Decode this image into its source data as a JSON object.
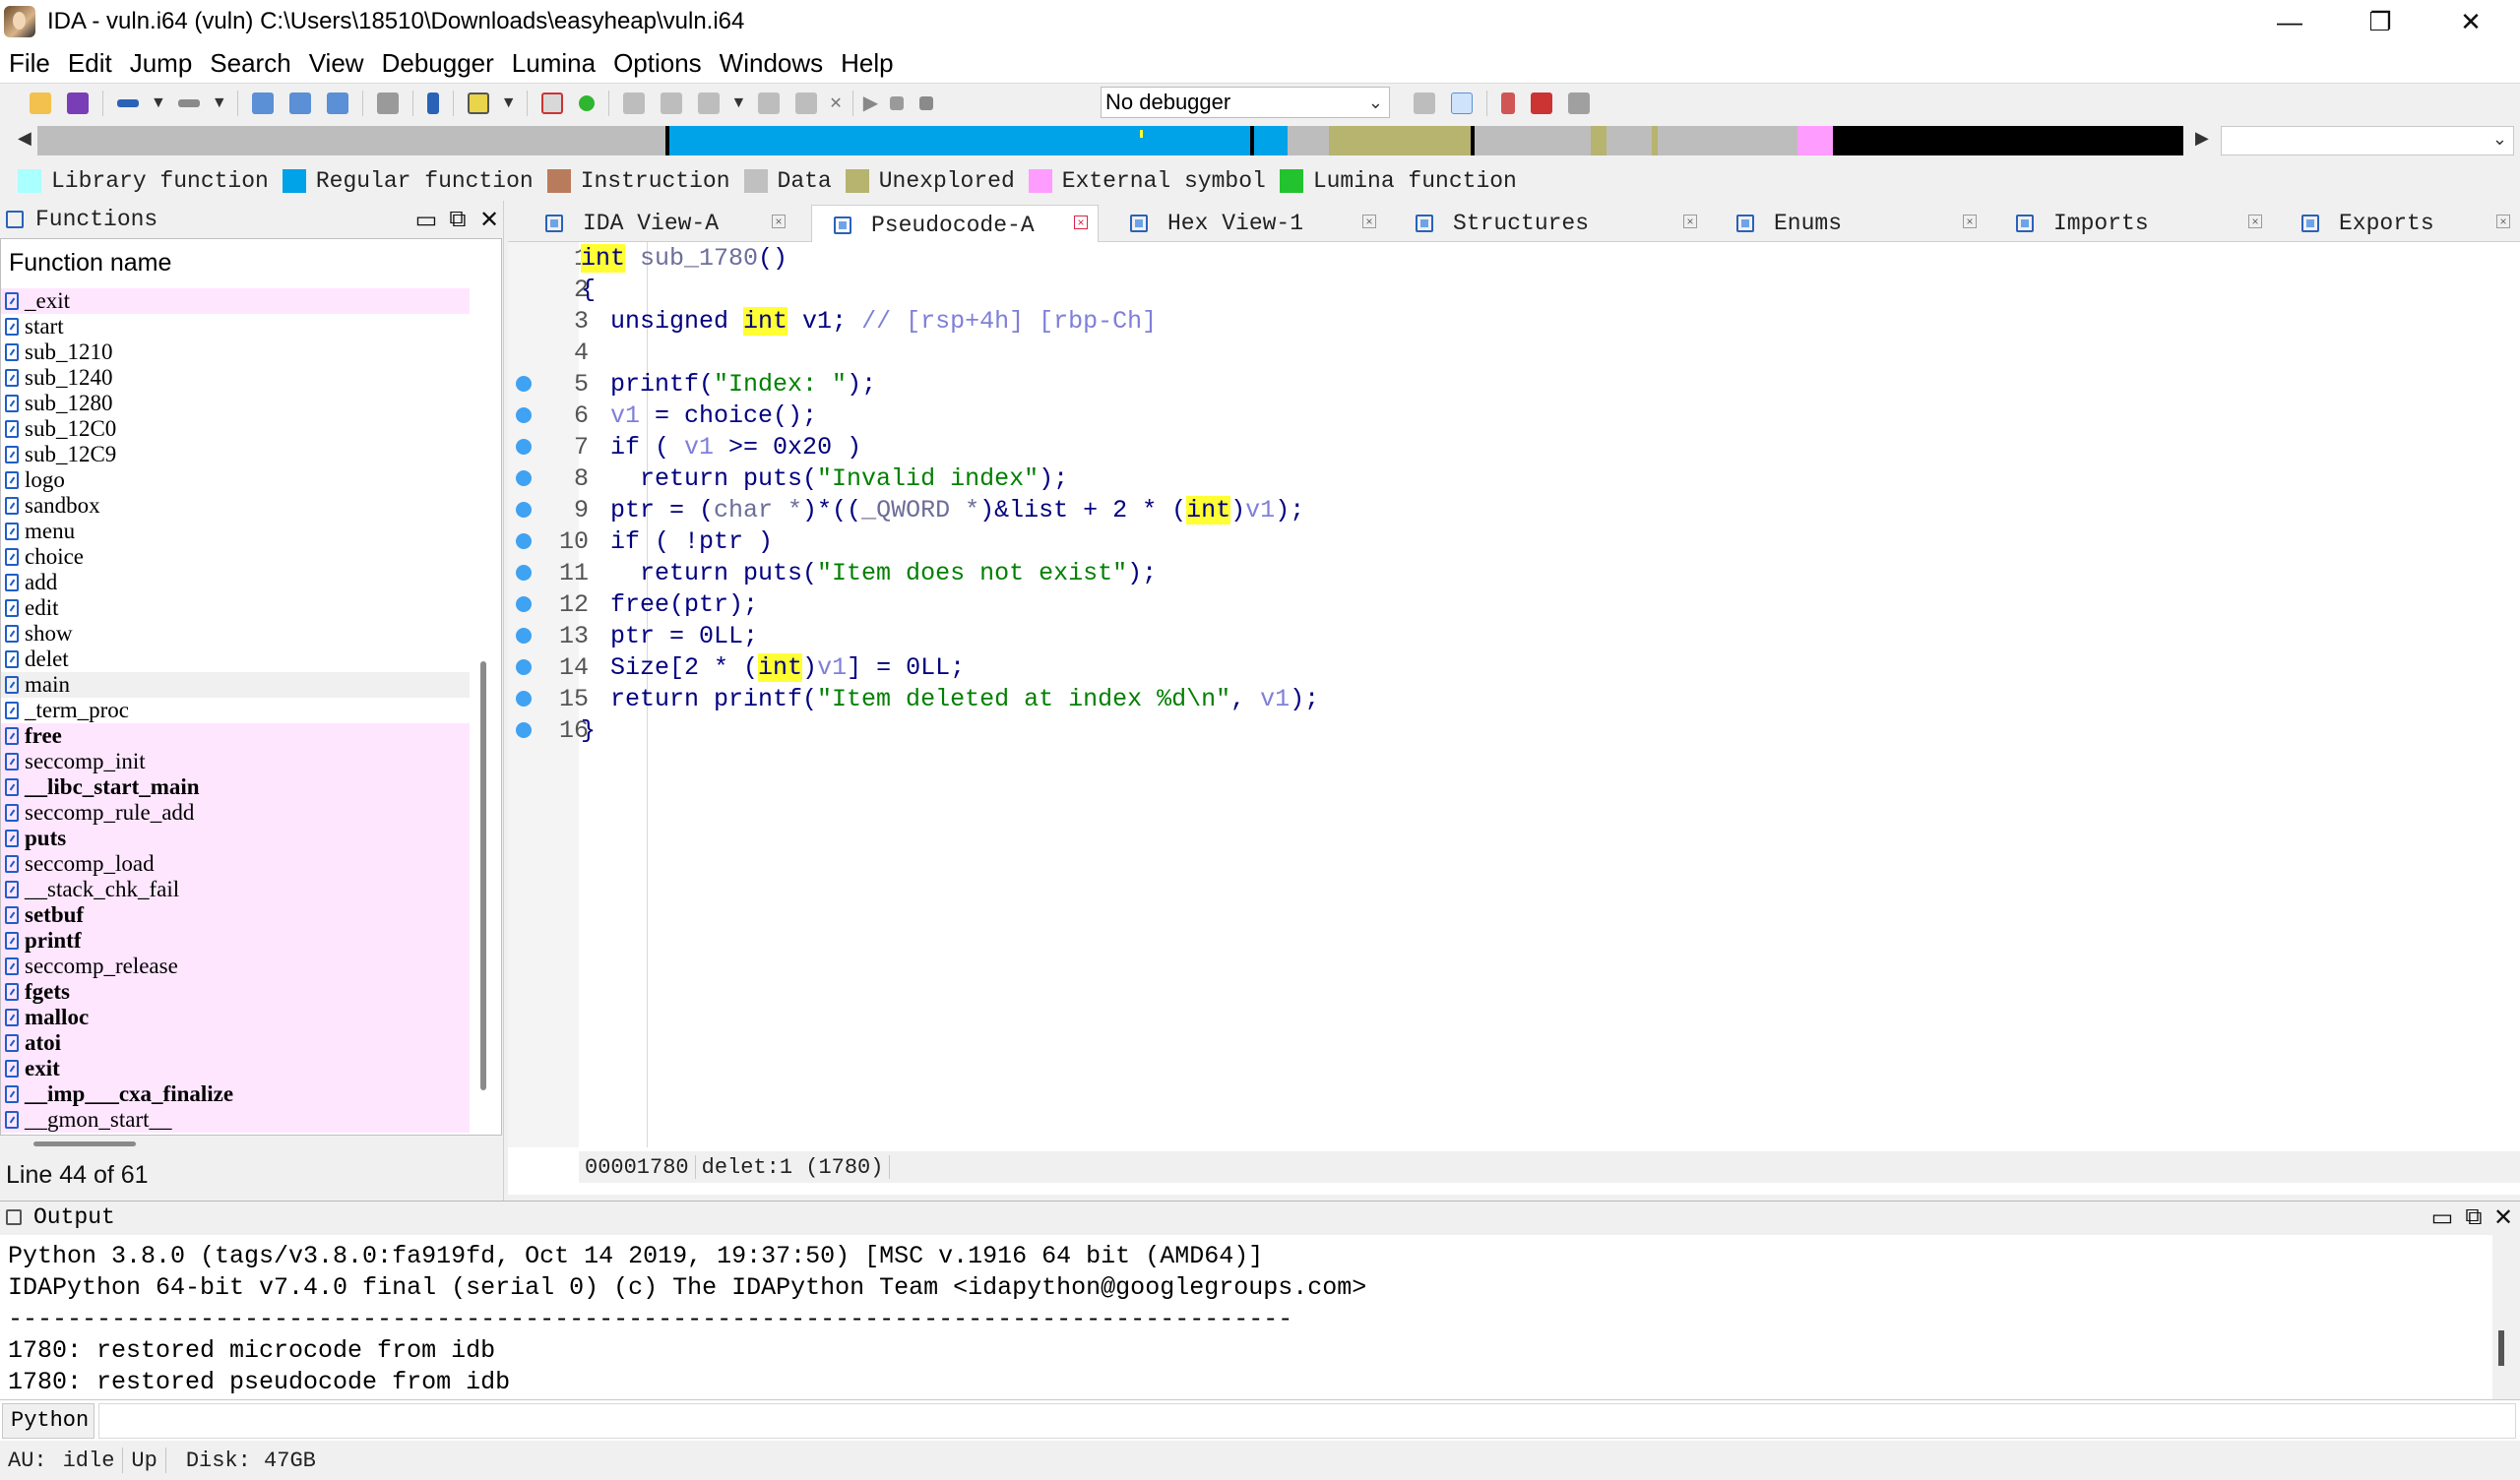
{
  "window": {
    "title": "IDA - vuln.i64 (vuln) C:\\Users\\18510\\Downloads\\easyheap\\vuln.i64",
    "minimize": "—",
    "maximize": "❐",
    "close": "✕"
  },
  "menu": [
    "File",
    "Edit",
    "Jump",
    "Search",
    "View",
    "Debugger",
    "Lumina",
    "Options",
    "Windows",
    "Help"
  ],
  "toolbar": {
    "debugger_select": "No debugger"
  },
  "legend": [
    {
      "label": "Library function",
      "color": "#aaffff"
    },
    {
      "label": "Regular function",
      "color": "#00a2e8"
    },
    {
      "label": "Instruction",
      "color": "#b87c5c"
    },
    {
      "label": "Data",
      "color": "#c0c0c0"
    },
    {
      "label": "Unexplored",
      "color": "#b6b46e"
    },
    {
      "label": "External symbol",
      "color": "#ff9cff"
    },
    {
      "label": "Lumina function",
      "color": "#22c32e"
    }
  ],
  "functions_panel": {
    "title": "Functions",
    "column_header": "Function name",
    "items": [
      {
        "name": "_exit",
        "type": "ext",
        "bold": false
      },
      {
        "name": "start",
        "type": "reg",
        "bold": false
      },
      {
        "name": "sub_1210",
        "type": "reg",
        "bold": false
      },
      {
        "name": "sub_1240",
        "type": "reg",
        "bold": false
      },
      {
        "name": "sub_1280",
        "type": "reg",
        "bold": false
      },
      {
        "name": "sub_12C0",
        "type": "reg",
        "bold": false
      },
      {
        "name": "sub_12C9",
        "type": "reg",
        "bold": false
      },
      {
        "name": "logo",
        "type": "reg",
        "bold": false
      },
      {
        "name": "sandbox",
        "type": "reg",
        "bold": false
      },
      {
        "name": "menu",
        "type": "reg",
        "bold": false
      },
      {
        "name": "choice",
        "type": "reg",
        "bold": false
      },
      {
        "name": "add",
        "type": "reg",
        "bold": false
      },
      {
        "name": "edit",
        "type": "reg",
        "bold": false
      },
      {
        "name": "show",
        "type": "reg",
        "bold": false
      },
      {
        "name": "delet",
        "type": "reg",
        "bold": false
      },
      {
        "name": "main",
        "type": "sel",
        "bold": false
      },
      {
        "name": "_term_proc",
        "type": "reg",
        "bold": false
      },
      {
        "name": "free",
        "type": "ext",
        "bold": true
      },
      {
        "name": "seccomp_init",
        "type": "ext",
        "bold": false
      },
      {
        "name": "__libc_start_main",
        "type": "ext",
        "bold": true
      },
      {
        "name": "seccomp_rule_add",
        "type": "ext",
        "bold": false
      },
      {
        "name": "puts",
        "type": "ext",
        "bold": true
      },
      {
        "name": "seccomp_load",
        "type": "ext",
        "bold": false
      },
      {
        "name": "__stack_chk_fail",
        "type": "ext",
        "bold": false
      },
      {
        "name": "setbuf",
        "type": "ext",
        "bold": true
      },
      {
        "name": "printf",
        "type": "ext",
        "bold": true
      },
      {
        "name": "seccomp_release",
        "type": "ext",
        "bold": false
      },
      {
        "name": "fgets",
        "type": "ext",
        "bold": true
      },
      {
        "name": "malloc",
        "type": "ext",
        "bold": true
      },
      {
        "name": "atoi",
        "type": "ext",
        "bold": true
      },
      {
        "name": "exit",
        "type": "ext",
        "bold": true
      },
      {
        "name": "__imp___cxa_finalize",
        "type": "ext",
        "bold": true
      },
      {
        "name": "__gmon_start__",
        "type": "ext",
        "bold": false
      }
    ],
    "line_status": "Line 44 of 61"
  },
  "tabs": [
    {
      "label": "IDA View-A",
      "active": false
    },
    {
      "label": "Pseudocode-A",
      "active": true
    },
    {
      "label": "Hex View-1",
      "active": false
    },
    {
      "label": "Structures",
      "active": false
    },
    {
      "label": "Enums",
      "active": false
    },
    {
      "label": "Imports",
      "active": false
    },
    {
      "label": "Exports",
      "active": false
    }
  ],
  "pseudocode": {
    "lines": [
      {
        "n": "1",
        "bp": false,
        "html": "<span class=\"hl kw\">int</span><span class=\"gray\"> sub_1780</span><span class=\"kw\">()</span>"
      },
      {
        "n": "2",
        "bp": false,
        "html": "<span class=\"kw\">{</span>"
      },
      {
        "n": "3",
        "bp": false,
        "html": "<span class=\"kw\">  unsigned </span><span class=\"hl kw\">int</span><span class=\"kw\"> v1; </span><span class=\"cm\">// [rsp+4h] [rbp-Ch]</span>"
      },
      {
        "n": "4",
        "bp": false,
        "html": ""
      },
      {
        "n": "5",
        "bp": true,
        "html": "<span class=\"kw\">  printf(</span><span class=\"str\">\"Index: \"</span><span class=\"kw\">);</span>"
      },
      {
        "n": "6",
        "bp": true,
        "html": "<span class=\"var\">  v1</span><span class=\"kw\"> = choice();</span>"
      },
      {
        "n": "7",
        "bp": true,
        "html": "<span class=\"kw\">  if ( </span><span class=\"var\">v1</span><span class=\"kw\"> &gt;= 0x20 )</span>"
      },
      {
        "n": "8",
        "bp": true,
        "html": "<span class=\"kw\">    return puts(</span><span class=\"str\">\"Invalid index\"</span><span class=\"kw\">);</span>"
      },
      {
        "n": "9",
        "bp": true,
        "html": "<span class=\"kw\">  ptr = (</span><span class=\"gray\">char *</span><span class=\"kw\">)*((</span><span class=\"gray\">_QWORD *</span><span class=\"kw\">)&amp;list + 2 * (</span><span class=\"hl kw\">int</span><span class=\"kw\">)</span><span class=\"var\">v1</span><span class=\"kw\">);</span>"
      },
      {
        "n": "10",
        "bp": true,
        "html": "<span class=\"kw\">  if ( !ptr )</span>"
      },
      {
        "n": "11",
        "bp": true,
        "html": "<span class=\"kw\">    return puts(</span><span class=\"str\">\"Item does not exist\"</span><span class=\"kw\">);</span>"
      },
      {
        "n": "12",
        "bp": true,
        "html": "<span class=\"kw\">  free(ptr);</span>"
      },
      {
        "n": "13",
        "bp": true,
        "html": "<span class=\"kw\">  ptr = 0LL;</span>"
      },
      {
        "n": "14",
        "bp": true,
        "html": "<span class=\"kw\">  Size[2 * (</span><span class=\"hl kw\">int</span><span class=\"kw\">)</span><span class=\"var\">v1</span><span class=\"kw\">] = 0LL;</span>"
      },
      {
        "n": "15",
        "bp": true,
        "html": "<span class=\"kw\">  return printf(</span><span class=\"str\">\"Item deleted at index %d\\n\"</span><span class=\"kw\">, </span><span class=\"var\">v1</span><span class=\"kw\">);</span>"
      },
      {
        "n": "16",
        "bp": true,
        "html": "<span class=\"kw\">}</span>"
      }
    ],
    "status_addr": "00001780",
    "status_loc": "delet:1 (1780)"
  },
  "output": {
    "title": "Output",
    "lines": [
      "Python 3.8.0 (tags/v3.8.0:fa919fd, Oct 14 2019, 19:37:50) [MSC v.1916 64 bit (AMD64)]",
      "IDAPython 64-bit v7.4.0 final (serial 0) (c) The IDAPython Team <idapython@googlegroups.com>",
      "---------------------------------------------------------------------------------------",
      "1780: restored microcode from idb",
      "1780: restored pseudocode from idb"
    ],
    "python_button": "Python"
  },
  "statusbar": {
    "au": "AU:",
    "state": "idle",
    "direction": "Up",
    "disk": "Disk: 47GB"
  }
}
